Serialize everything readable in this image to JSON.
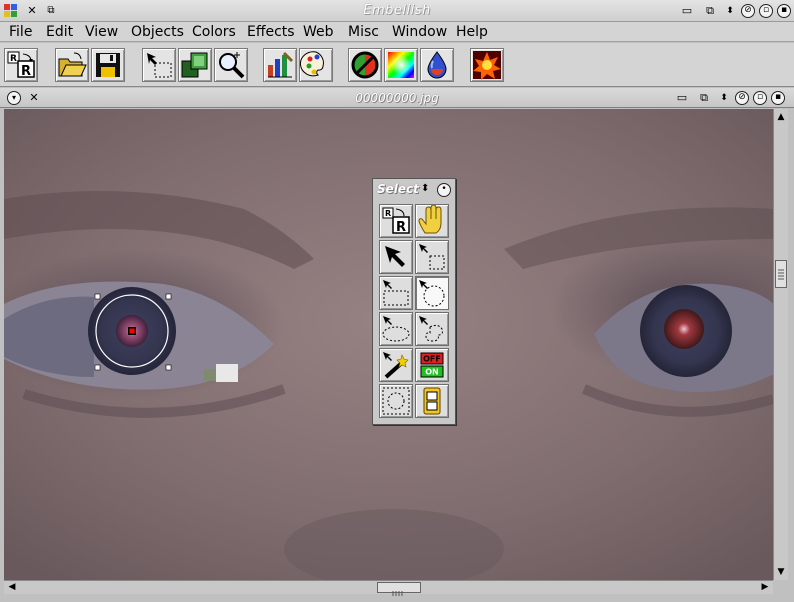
{
  "window": {
    "title": "Embellish"
  },
  "menu": [
    "File",
    "Edit",
    "View",
    "Objects",
    "Colors",
    "Effects",
    "Web",
    "Misc",
    "Window",
    "Help"
  ],
  "document": {
    "title": "00000000.jpg"
  },
  "palette": {
    "title": "Select"
  },
  "toggle_labels": {
    "off": "OFF",
    "on": "ON"
  },
  "colors": {
    "canvas_skin": "#8f7a7a",
    "selection_marker": "#ff0000",
    "chrome": "#d4d4d4"
  }
}
